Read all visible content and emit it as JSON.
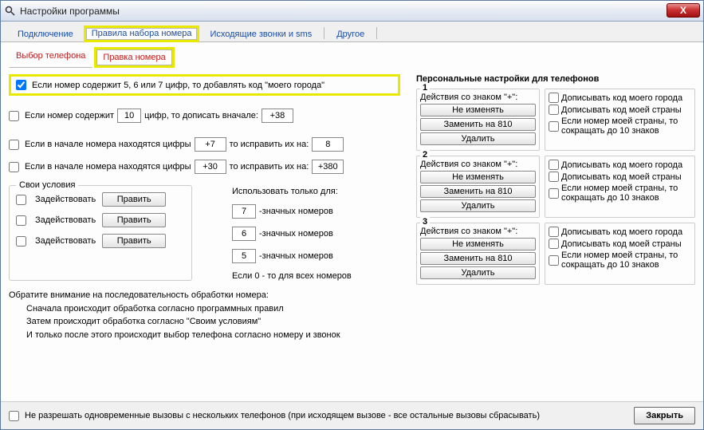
{
  "window": {
    "title": "Настройки программы",
    "close_x": "X"
  },
  "tabs1": {
    "connection": "Подключение",
    "dial_rules": "Правила набора номера",
    "outgoing": "Исходящие звонки и sms",
    "other": "Другое"
  },
  "tabs2": {
    "select_phone": "Выбор телефона",
    "edit_number": "Правка номера"
  },
  "left": {
    "add_city_code_checked": true,
    "add_city_code": "Если номер содержит 5, 6 или 7 цифр, то добавлять код \"моего города\"",
    "digits_prefix_chk": "Если номер содержит",
    "digits_prefix_val": "10",
    "digits_prefix_suffix": "цифр, то дописать вначале:",
    "digits_prefix_code": "+38",
    "fix1_chk": "Если в начале номера находятся цифры",
    "fix1_from": "+7",
    "fix1_mid": "то исправить их на:",
    "fix1_to": "8",
    "fix2_chk": "Если в начале номера находятся цифры",
    "fix2_from": "+30",
    "fix2_mid": "то исправить их на:",
    "fix2_to": "+380",
    "own_cond_legend": "Свои условия",
    "use_label": "Задействовать",
    "edit_label": "Править",
    "use_only_label": "Использовать только для:",
    "use_only_vals": [
      "7",
      "6",
      "5"
    ],
    "use_only_suffix": "-значных номеров",
    "use_only_zero": "Если 0 - то для всех номеров",
    "note_title": "Обратите внимание на последовательность обработки номера:",
    "note1": "Сначала происходит обработка согласно программных правил",
    "note2": "Затем происходит обработка согласно \"Своим условиям\"",
    "note3": "И только после этого происходит выбор телефона согласно номеру и звонок"
  },
  "right": {
    "title": "Персональные настройки для телефонов",
    "action_label": "Действия со знаком \"+\":",
    "btn_nochange": "Не изменять",
    "btn_replace": "Заменить на 810",
    "btn_delete": "Удалить",
    "chk_city": "Дописывать код моего города",
    "chk_country": "Дописывать код моей страны",
    "chk_trim": "Если номер моей страны, то сокращать до 10 знаков",
    "nums": [
      "1",
      "2",
      "3"
    ]
  },
  "footer": {
    "disallow": "Не разрешать одновременные вызовы с нескольких телефонов (при исходящем вызове - все остальные вызовы сбрасывать)",
    "close": "Закрыть"
  }
}
